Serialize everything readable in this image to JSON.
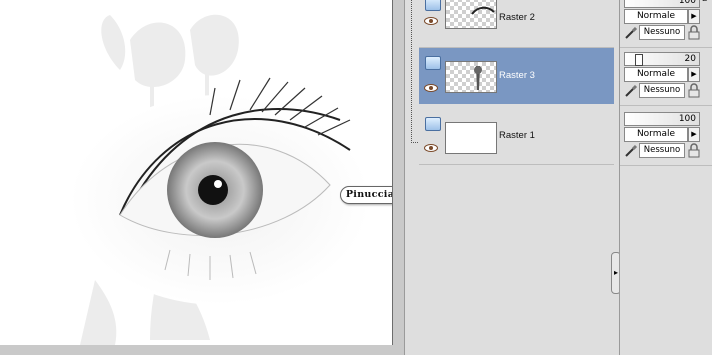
{
  "canvas": {
    "signature": "Pinuccia"
  },
  "layers": [
    {
      "name": "Raster 2",
      "selected": false,
      "thumb": "eyelash-stroke"
    },
    {
      "name": "Raster 3",
      "selected": true,
      "thumb": "flower-silhouette"
    },
    {
      "name": "Raster 1",
      "selected": false,
      "thumb": "white-fill"
    }
  ],
  "layer_props": [
    {
      "opacity": "100",
      "blend": "Normale",
      "mask": "Nessuno"
    },
    {
      "opacity": "20",
      "blend": "Normale",
      "mask": "Nessuno"
    },
    {
      "opacity": "100",
      "blend": "Normale",
      "mask": "Nessuno"
    }
  ],
  "colors": {
    "selection": "#7a97c2",
    "panel_bg": "#dedede"
  },
  "icons": [
    "eye-icon",
    "raster-layer-icon",
    "dropdown-arrow-icon",
    "brush-icon",
    "lock-icon"
  ]
}
